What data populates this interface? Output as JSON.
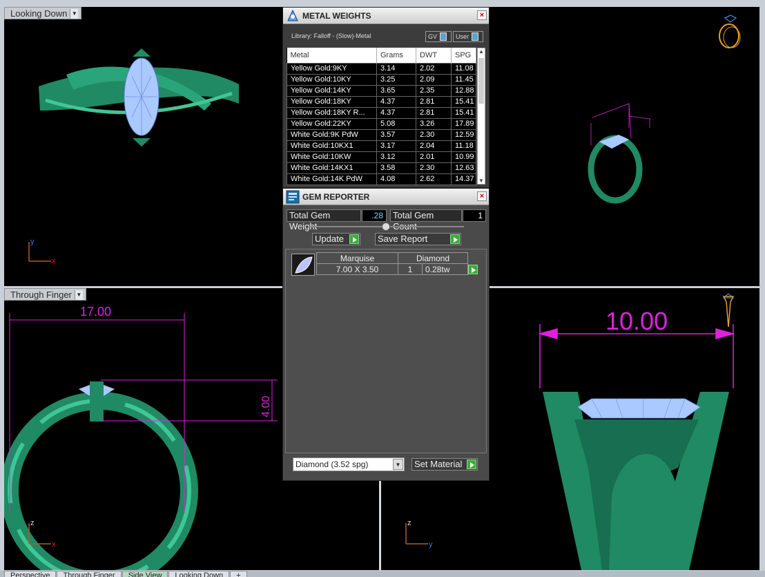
{
  "viewports": {
    "top_left_label": "Looking Down",
    "bottom_left_label": "Through Finger",
    "dim_width_bl": "17.00",
    "dim_height_bl": "4.00",
    "dim_width_br": "10.00",
    "axis": {
      "x": "x",
      "y": "y",
      "z": "z"
    }
  },
  "metal_weights": {
    "title": "METAL WEIGHTS",
    "library": "Library: Falloff - (Slow)-Metal",
    "toggle_gv": "GV",
    "toggle_user": "User",
    "columns": [
      "Metal",
      "Grams",
      "DWT",
      "SPG"
    ],
    "rows": [
      [
        "Yellow Gold:9KY",
        "3.14",
        "2.02",
        "11.08"
      ],
      [
        "Yellow Gold:10KY",
        "3.25",
        "2.09",
        "11.45"
      ],
      [
        "Yellow Gold:14KY",
        "3.65",
        "2.35",
        "12.88"
      ],
      [
        "Yellow Gold:18KY",
        "4.37",
        "2.81",
        "15.41"
      ],
      [
        "Yellow Gold:18KY R...",
        "4.37",
        "2.81",
        "15.41"
      ],
      [
        "Yellow Gold:22KY",
        "5.08",
        "3.26",
        "17.89"
      ],
      [
        "White Gold:9K PdW",
        "3.57",
        "2.30",
        "12.59"
      ],
      [
        "White Gold:10KX1",
        "3.17",
        "2.04",
        "11.18"
      ],
      [
        "White Gold:10KW",
        "3.12",
        "2.01",
        "10.99"
      ],
      [
        "White Gold:14KX1",
        "3.58",
        "2.30",
        "12.63"
      ],
      [
        "White Gold:14K PdW",
        "4.08",
        "2.62",
        "14.37"
      ]
    ]
  },
  "gem_reporter": {
    "title": "GEM REPORTER",
    "total_weight_label": "Total Gem Weight",
    "total_weight_value": ".28",
    "total_count_label": "Total Gem Count",
    "total_count_value": "1",
    "update_label": "Update",
    "save_report_label": "Save Report",
    "gem": {
      "shape": "Marquise",
      "material": "Diamond",
      "size": "7.00 X 3.50",
      "count": "1",
      "weight": "0.28tw"
    },
    "material_select": "Diamond     (3.52 spg)",
    "set_material_label": "Set Material"
  },
  "tabs": [
    "Perspective",
    "Through Finger",
    "Side View",
    "Looking Down",
    "+"
  ],
  "colors": {
    "ring": "#1f8a64",
    "gem": "#a9c9ff",
    "dimension": "#e020e0",
    "panel_bg": "#4a4a4a"
  }
}
